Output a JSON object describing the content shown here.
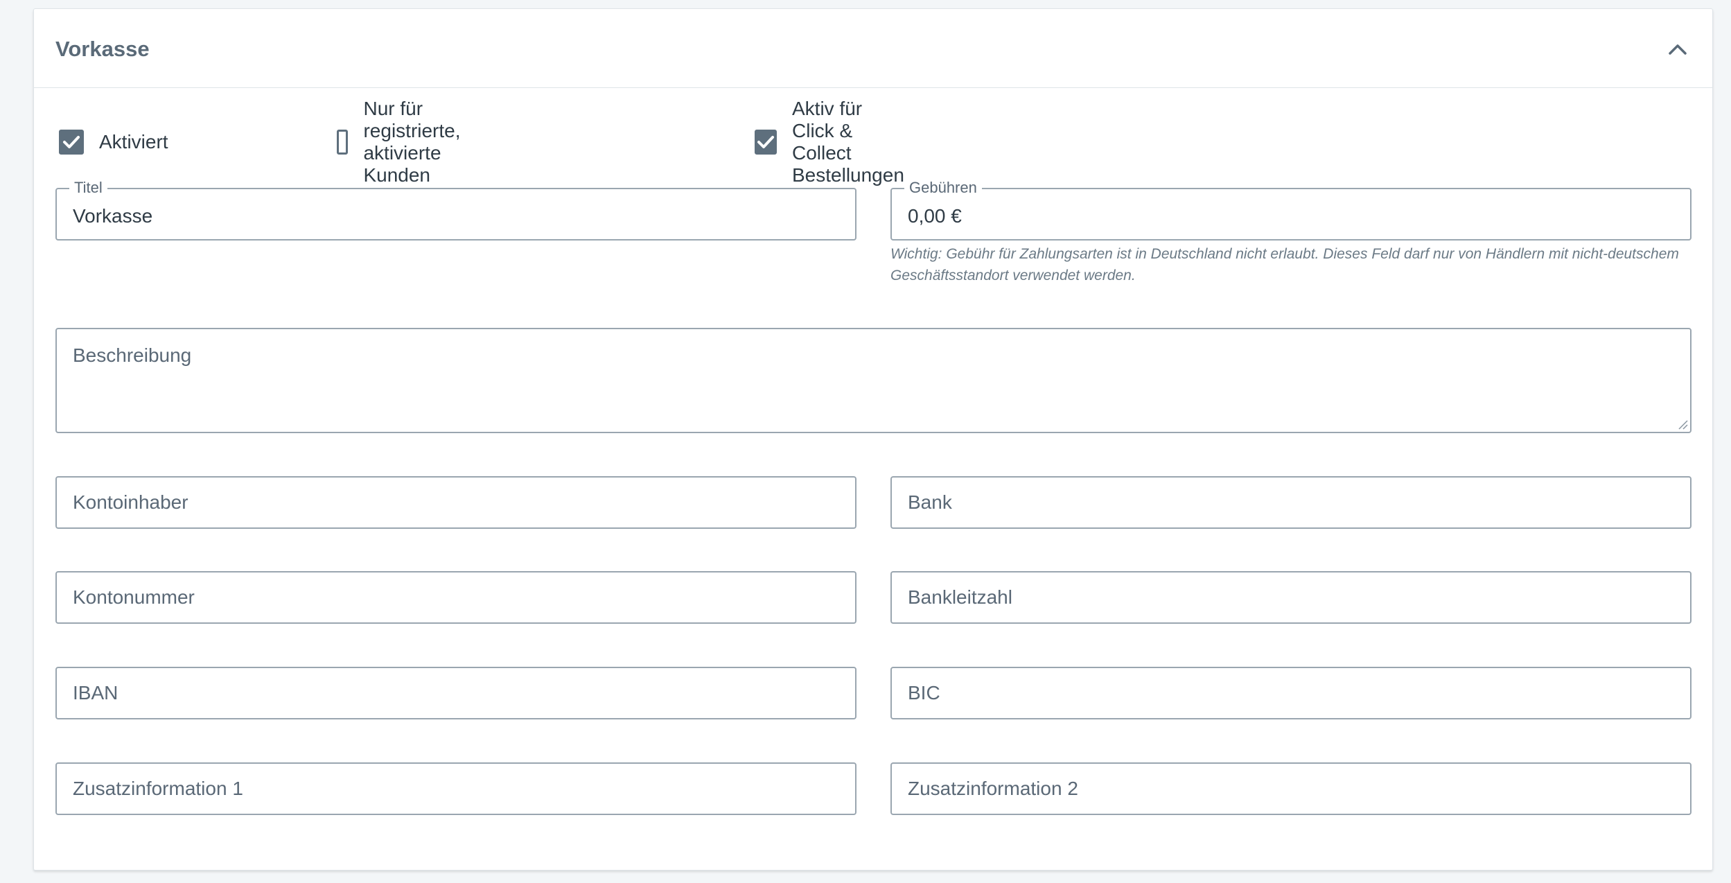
{
  "card": {
    "title": "Vorkasse",
    "collapse_icon": "chevron-up-icon"
  },
  "checkboxes": [
    {
      "label": "Aktiviert",
      "checked": true
    },
    {
      "label": "Nur für registrierte, aktivierte Kunden",
      "checked": false
    },
    {
      "label": "Aktiv für Click & Collect Bestellungen",
      "checked": true
    }
  ],
  "fields": {
    "title": {
      "label": "Titel",
      "value": "Vorkasse"
    },
    "fee": {
      "label": "Gebühren",
      "value": "0,00 €",
      "hint": "Wichtig: Gebühr für Zahlungsarten ist in Deutschland nicht erlaubt. Dieses Feld darf nur von Händlern mit nicht-deutschem Geschäftsstandort verwendet werden."
    },
    "description": {
      "placeholder": "Beschreibung"
    },
    "account_holder": {
      "placeholder": "Kontoinhaber"
    },
    "bank": {
      "placeholder": "Bank"
    },
    "account_number": {
      "placeholder": "Kontonummer"
    },
    "bank_code": {
      "placeholder": "Bankleitzahl"
    },
    "iban": {
      "placeholder": "IBAN"
    },
    "bic": {
      "placeholder": "BIC"
    },
    "extra_info_1": {
      "placeholder": "Zusatzinformation 1"
    },
    "extra_info_2": {
      "placeholder": "Zusatzinformation 2"
    }
  },
  "colors": {
    "accent": "#5e6f7d",
    "border": "#9aa6b0",
    "background": "#f3f6f8"
  }
}
